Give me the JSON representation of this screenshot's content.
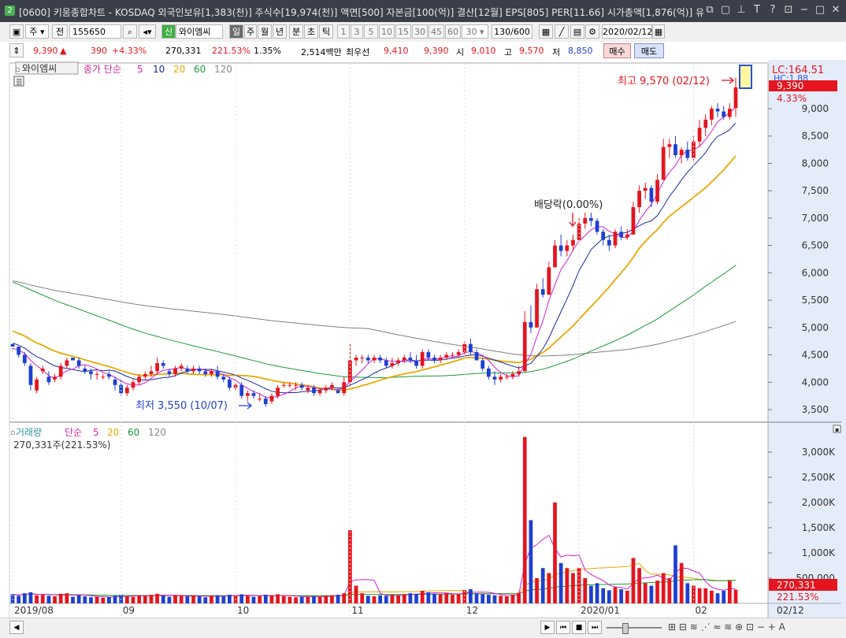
{
  "window": {
    "title": "[0600] 키움종합차트 - KOSDAQ 외국인보유[1,383(천)] 주식수[19,974(천)] 액면[500] 자본금[100(억)] 결산[12월] EPS[805] PER[11.66] 시가총액[1,876(억)] 유",
    "icon_label": "2"
  },
  "toolbar": {
    "period": "주",
    "prev": "전",
    "code": "155650",
    "credit_badge": "신",
    "stock_name": "와이엠씨",
    "timeframes": [
      "일",
      "주",
      "월",
      "년",
      "분",
      "초",
      "틱"
    ],
    "intervals": [
      "1",
      "3",
      "5",
      "10",
      "15",
      "30",
      "45",
      "60"
    ],
    "interval_value": "30",
    "count": "130/600",
    "date": "2020/02/12"
  },
  "quote": {
    "price": "9,390",
    "change_arrow": "▲",
    "change": "390",
    "change_pct": "+4.33%",
    "volume": "270,331",
    "volume_ratio": "221.53%",
    "turnover": "1.35%",
    "amount": "2,514백만",
    "best_ask_label": "최우선",
    "best_ask": "9,410",
    "best_bid": "9,390",
    "open_label": "시",
    "open": "9,010",
    "high_label": "고",
    "high": "9,570",
    "low_label": "저",
    "low": "8,850",
    "buy_label": "매수",
    "sell_label": "매도"
  },
  "price_panel": {
    "name": "와이엠씨",
    "indicator_label": "종가 단순",
    "ma_periods": [
      "5",
      "10",
      "20",
      "60",
      "120"
    ],
    "lc_label": "LC:164.51",
    "current_price": "9,390",
    "current_pct": "4.33%",
    "high_annotation": "최고 9,570 (02/12)",
    "low_annotation": "최저 3,550 (10/07)",
    "dividend_annotation": "배당락(0.00%)",
    "axis_ticks": [
      "9,000",
      "8,500",
      "8,000",
      "7,500",
      "7,000",
      "6,500",
      "6,000",
      "5,500",
      "5,000",
      "4,500",
      "4,000",
      "3,500"
    ]
  },
  "volume_panel": {
    "name": "거래량",
    "indicator_label": "단순",
    "ma_periods": [
      "5",
      "20",
      "60",
      "120"
    ],
    "current_volume": "270,331주(221.53%)",
    "current_value": "270,331",
    "current_pct": "221.53%",
    "axis_ticks": [
      "3,000K",
      "2,500K",
      "2,000K",
      "1,500K",
      "1,000K",
      "500,000"
    ]
  },
  "x_axis": {
    "labels": [
      "2019/08",
      "09",
      "10",
      "11",
      "12",
      "2020/01",
      "02"
    ],
    "last_date": "02/12"
  },
  "colors": {
    "up": "#e4151e",
    "down": "#1e3fd0",
    "ma5": "#d020d0",
    "ma10": "#1a2a9a",
    "ma20": "#e8a800",
    "ma60": "#1a9a3a",
    "ma120": "#808080",
    "axis_bg": "#e4ecfa"
  },
  "chart_data": {
    "type": "candlestick",
    "price_axis": {
      "min": 3500,
      "max": 9000,
      "step": 500
    },
    "volume_axis": {
      "min": 0,
      "max": 3000000,
      "step": 500000
    },
    "candles": [
      [
        4700,
        4700,
        4600,
        4650,
        180000
      ],
      [
        4650,
        4650,
        4450,
        4500,
        150000
      ],
      [
        4500,
        4550,
        4300,
        4350,
        200000
      ],
      [
        4300,
        4350,
        3850,
        3950,
        220000
      ],
      [
        3850,
        4100,
        3800,
        4050,
        160000
      ],
      [
        4200,
        4300,
        4150,
        4250,
        170000
      ],
      [
        4100,
        4200,
        3950,
        4000,
        150000
      ],
      [
        4050,
        4150,
        4000,
        4100,
        140000
      ],
      [
        4100,
        4350,
        4050,
        4300,
        190000
      ],
      [
        4300,
        4450,
        4250,
        4400,
        200000
      ],
      [
        4450,
        4450,
        4400,
        4400,
        130000
      ],
      [
        4400,
        4450,
        4250,
        4300,
        160000
      ],
      [
        4250,
        4300,
        4150,
        4200,
        140000
      ],
      [
        4200,
        4250,
        4050,
        4150,
        120000
      ],
      [
        4150,
        4200,
        4050,
        4150,
        130000
      ],
      [
        4100,
        4150,
        4050,
        4100,
        110000
      ],
      [
        4150,
        4200,
        4050,
        4100,
        125000
      ],
      [
        4050,
        4100,
        3850,
        3950,
        150000
      ],
      [
        3950,
        4050,
        3750,
        3800,
        170000
      ],
      [
        3800,
        3950,
        3750,
        3900,
        140000
      ],
      [
        3900,
        4050,
        3850,
        4000,
        130000
      ],
      [
        4000,
        4150,
        3950,
        4100,
        160000
      ],
      [
        4100,
        4200,
        4050,
        4150,
        150000
      ],
      [
        4150,
        4300,
        4100,
        4200,
        170000
      ],
      [
        4200,
        4450,
        4150,
        4350,
        190000
      ],
      [
        4350,
        4400,
        4250,
        4300,
        150000
      ],
      [
        4200,
        4250,
        4100,
        4150,
        130000
      ],
      [
        4150,
        4300,
        4100,
        4250,
        160000
      ],
      [
        4250,
        4350,
        4200,
        4300,
        150000
      ],
      [
        4250,
        4300,
        4150,
        4200,
        140000
      ],
      [
        4200,
        4300,
        4150,
        4250,
        155000
      ],
      [
        4250,
        4300,
        4150,
        4200,
        140000
      ],
      [
        4200,
        4250,
        4100,
        4150,
        120000
      ],
      [
        4150,
        4250,
        4100,
        4200,
        150000
      ],
      [
        4200,
        4300,
        4050,
        4100,
        160000
      ],
      [
        4100,
        4150,
        4000,
        4050,
        140000
      ],
      [
        4050,
        4100,
        3850,
        3900,
        170000
      ],
      [
        3900,
        4000,
        3850,
        3950,
        160000
      ],
      [
        3950,
        4000,
        3700,
        3750,
        180000
      ],
      [
        3750,
        3850,
        3650,
        3800,
        150000
      ],
      [
        3800,
        3850,
        3700,
        3750,
        130000
      ],
      [
        3700,
        3800,
        3650,
        3700,
        140000
      ],
      [
        3700,
        3750,
        3550,
        3600,
        170000
      ],
      [
        3650,
        3800,
        3600,
        3750,
        160000
      ],
      [
        3750,
        3950,
        3700,
        3900,
        180000
      ],
      [
        3950,
        4000,
        3900,
        3950,
        140000
      ],
      [
        3950,
        4000,
        3900,
        3950,
        130000
      ],
      [
        3950,
        4000,
        3850,
        3950,
        120000
      ],
      [
        3950,
        4000,
        3850,
        3900,
        130000
      ],
      [
        3850,
        3950,
        3800,
        3900,
        125000
      ],
      [
        3900,
        3950,
        3750,
        3800,
        140000
      ],
      [
        3800,
        3900,
        3750,
        3850,
        130000
      ],
      [
        3850,
        3950,
        3800,
        3900,
        150000
      ],
      [
        3900,
        4000,
        3850,
        3950,
        160000
      ],
      [
        3850,
        3900,
        3800,
        3800,
        170000
      ],
      [
        3800,
        4100,
        3750,
        4000,
        200000
      ],
      [
        4000,
        4700,
        3950,
        4400,
        1450000
      ],
      [
        4400,
        4500,
        4300,
        4450,
        350000
      ],
      [
        4450,
        4500,
        4350,
        4450,
        200000
      ],
      [
        4450,
        4500,
        4350,
        4400,
        150000
      ],
      [
        4400,
        4500,
        4350,
        4450,
        140000
      ],
      [
        4450,
        4500,
        4350,
        4400,
        160000
      ],
      [
        4400,
        4450,
        4250,
        4300,
        150000
      ],
      [
        4300,
        4450,
        4250,
        4350,
        170000
      ],
      [
        4350,
        4450,
        4300,
        4400,
        160000
      ],
      [
        4400,
        4500,
        4350,
        4450,
        180000
      ],
      [
        4450,
        4550,
        4350,
        4400,
        200000
      ],
      [
        4400,
        4500,
        4250,
        4300,
        190000
      ],
      [
        4300,
        4600,
        4250,
        4550,
        250000
      ],
      [
        4550,
        4600,
        4400,
        4450,
        220000
      ],
      [
        4450,
        4500,
        4350,
        4400,
        190000
      ],
      [
        4400,
        4500,
        4350,
        4450,
        180000
      ],
      [
        4450,
        4550,
        4400,
        4500,
        200000
      ],
      [
        4500,
        4550,
        4450,
        4500,
        170000
      ],
      [
        4500,
        4600,
        4450,
        4550,
        190000
      ],
      [
        4550,
        4750,
        4500,
        4700,
        260000
      ],
      [
        4700,
        4800,
        4500,
        4550,
        280000
      ],
      [
        4550,
        4600,
        4400,
        4400,
        200000
      ],
      [
        4400,
        4450,
        4200,
        4250,
        180000
      ],
      [
        4250,
        4300,
        4050,
        4100,
        170000
      ],
      [
        4100,
        4200,
        3950,
        4050,
        160000
      ],
      [
        4050,
        4150,
        4000,
        4100,
        150000
      ],
      [
        4100,
        4150,
        4050,
        4100,
        140000
      ],
      [
        4100,
        4200,
        4050,
        4150,
        170000
      ],
      [
        4150,
        4300,
        4100,
        4200,
        210000
      ],
      [
        4200,
        5300,
        4200,
        5100,
        3300000
      ],
      [
        5100,
        5400,
        4900,
        5000,
        1650000
      ],
      [
        5000,
        5800,
        5000,
        5700,
        500000
      ],
      [
        5700,
        5900,
        5550,
        5600,
        700000
      ],
      [
        5600,
        6200,
        5600,
        6100,
        600000
      ],
      [
        6100,
        6600,
        6100,
        6500,
        2000000
      ],
      [
        6500,
        6700,
        6300,
        6400,
        800000
      ],
      [
        6400,
        6600,
        6300,
        6500,
        700000
      ],
      [
        6500,
        6700,
        6400,
        6600,
        600000
      ],
      [
        6600,
        7000,
        6600,
        6900,
        700000
      ],
      [
        6900,
        7100,
        6800,
        7000,
        500000
      ],
      [
        7000,
        7100,
        6850,
        6950,
        350000
      ],
      [
        6950,
        7000,
        6700,
        6750,
        400000
      ],
      [
        6750,
        6800,
        6500,
        6600,
        300000
      ],
      [
        6600,
        6700,
        6400,
        6500,
        260000
      ],
      [
        6500,
        6800,
        6450,
        6750,
        320000
      ],
      [
        6750,
        6850,
        6600,
        6650,
        280000
      ],
      [
        6650,
        6800,
        6600,
        6700,
        250000
      ],
      [
        6700,
        7300,
        6700,
        7200,
        900000
      ],
      [
        7200,
        7600,
        7100,
        7500,
        700000
      ],
      [
        7500,
        7650,
        7350,
        7550,
        400000
      ],
      [
        7550,
        7600,
        7200,
        7300,
        350000
      ],
      [
        7300,
        7800,
        7250,
        7700,
        450000
      ],
      [
        7700,
        8450,
        7700,
        8300,
        600000
      ],
      [
        8300,
        8450,
        8100,
        8350,
        500000
      ],
      [
        8350,
        8500,
        8100,
        8150,
        1150000
      ],
      [
        8150,
        8300,
        8000,
        8250,
        800000
      ],
      [
        8250,
        8400,
        8050,
        8100,
        400000
      ],
      [
        8100,
        8500,
        8050,
        8400,
        350000
      ],
      [
        8400,
        8800,
        8300,
        8650,
        300000
      ],
      [
        8650,
        8900,
        8500,
        8800,
        300000
      ],
      [
        8800,
        9050,
        8700,
        9000,
        250000
      ],
      [
        9000,
        9100,
        8850,
        8950,
        200000
      ],
      [
        8950,
        9050,
        8800,
        8850,
        250000
      ],
      [
        8850,
        9100,
        8800,
        9000,
        450000
      ],
      [
        9010,
        9570,
        8850,
        9390,
        270331
      ]
    ]
  }
}
